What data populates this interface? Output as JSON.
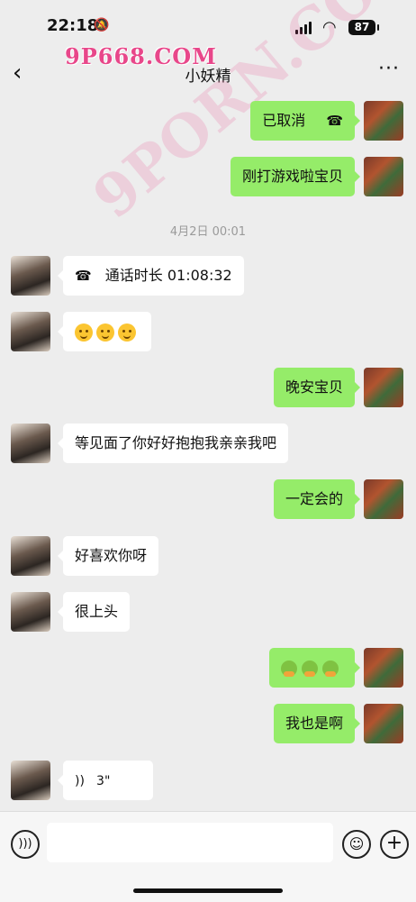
{
  "status": {
    "time": "22:18",
    "battery": "87"
  },
  "header": {
    "title": "小妖精",
    "back": "‹",
    "more": "···"
  },
  "watermark": {
    "top": "9P668.COM",
    "diag": "9PORN.COM"
  },
  "messages": [
    {
      "side": "self",
      "text": "已取消",
      "icon": "phone-hangup-icon"
    },
    {
      "side": "self",
      "text": "刚打游戏啦宝贝"
    },
    {
      "type": "timestamp",
      "text": "4月2日 00:01"
    },
    {
      "side": "peer",
      "text": "通话时长 01:08:32",
      "icon": "phone-hangup-icon"
    },
    {
      "side": "peer",
      "text": "",
      "emoji": "smile-face x3"
    },
    {
      "side": "self",
      "text": "晚安宝贝"
    },
    {
      "side": "peer",
      "text": "等见面了你好好抱抱我亲亲我吧"
    },
    {
      "side": "self",
      "text": "一定会的"
    },
    {
      "side": "peer",
      "text": "好喜欢你呀"
    },
    {
      "side": "peer",
      "text": "很上头"
    },
    {
      "side": "self",
      "text": "",
      "emoji": "green-emoji x3"
    },
    {
      "side": "self",
      "text": "我也是啊"
    },
    {
      "side": "peer",
      "text": "3\"",
      "icon": "voice-wave-icon"
    }
  ],
  "colors": {
    "self_bubble": "#95ec69",
    "peer_bubble": "#ffffff",
    "background": "#ededed"
  },
  "input": {
    "placeholder": ""
  }
}
